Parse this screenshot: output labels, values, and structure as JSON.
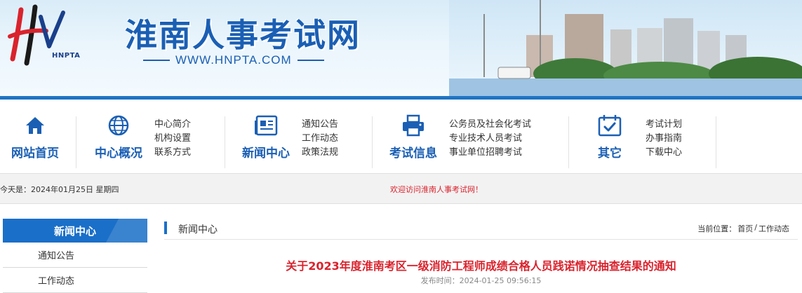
{
  "header": {
    "logo_text": "HNPTA",
    "site_title": "淮南人事考试网",
    "site_url": "WWW.HNPTA.COM"
  },
  "nav": [
    {
      "label": "网站首页",
      "icon": "home-icon",
      "links": []
    },
    {
      "label": "中心概况",
      "icon": "globe-icon",
      "links": [
        "中心简介",
        "机构设置",
        "联系方式"
      ]
    },
    {
      "label": "新闻中心",
      "icon": "newspaper-icon",
      "links": [
        "通知公告",
        "工作动态",
        "政策法规"
      ]
    },
    {
      "label": "考试信息",
      "icon": "printer-icon",
      "links": [
        "公务员及社会化考试",
        "专业技术人员考试",
        "事业单位招聘考试"
      ]
    },
    {
      "label": "其它",
      "icon": "calendar-check-icon",
      "links": [
        "考试计划",
        "办事指南",
        "下载中心"
      ]
    }
  ],
  "infobar": {
    "today": "今天是：2024年01月25日 星期四",
    "welcome": "欢迎访问淮南人事考试网！"
  },
  "sidebar": {
    "title": "新闻中心",
    "items": [
      "通知公告",
      "工作动态"
    ]
  },
  "main": {
    "section_title": "新闻中心",
    "breadcrumb": {
      "prefix": "当前位置：",
      "home": "首页",
      "sep": "/",
      "current": "工作动态"
    },
    "article_title": "关于2023年度淮南考区一级消防工程师成绩合格人员践诺情况抽查结果的通知",
    "publish_time": "发布时间：2024-01-25 09:56:15"
  },
  "colors": {
    "brand_blue": "#1a5fb4",
    "accent_red": "#d9232d",
    "sidebar_blue": "#1a6fc8"
  }
}
